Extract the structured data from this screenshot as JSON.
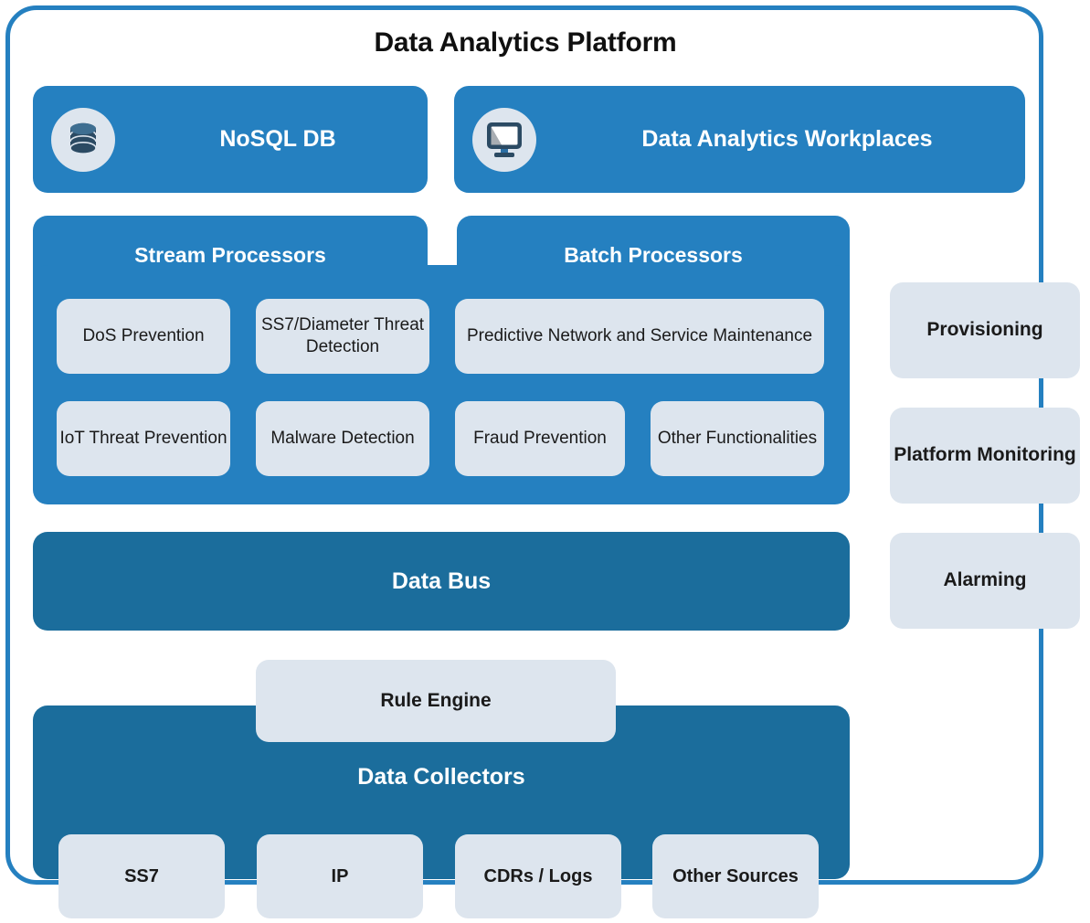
{
  "platform": {
    "title": "Data Analytics Platform",
    "accent_blue": "#2580c0",
    "dark_blue": "#1b6d9c",
    "light_box": "#dde5ee",
    "icon_navy": "#2b4a63"
  },
  "top_row": [
    {
      "label": "NoSQL DB",
      "icon": "database-icon"
    },
    {
      "label": "Data Analytics Workplaces",
      "icon": "monitor-icon"
    }
  ],
  "processors": {
    "stream": {
      "title": "Stream Processors",
      "items": [
        "DoS\nPrevention",
        "SS7/Diameter\nThreat Detection",
        "IoT Threat\nPrevention",
        "Malware\nDetection"
      ],
      "item_1": "DoS Prevention",
      "item_2": "SS7/Diameter Threat Detection",
      "item_3": "IoT Threat Prevention",
      "item_4": "Malware Detection"
    },
    "batch": {
      "title": "Batch Processors",
      "item_1": "Predictive Network and Service Maintenance",
      "item_2": "Fraud Prevention",
      "item_3": "Other Functionalities"
    }
  },
  "data_bus": {
    "label": "Data Bus"
  },
  "rule_engine": {
    "label": "Rule Engine"
  },
  "data_collectors": {
    "label": "Data Collectors"
  },
  "sources": [
    {
      "label": "SS7"
    },
    {
      "label": "IP"
    },
    {
      "label": "CDRs / Logs"
    },
    {
      "label": "Other Sources"
    }
  ],
  "operations": [
    {
      "label": "Provisioning"
    },
    {
      "label": "Platform Monitoring"
    },
    {
      "label": "Alarming"
    }
  ]
}
